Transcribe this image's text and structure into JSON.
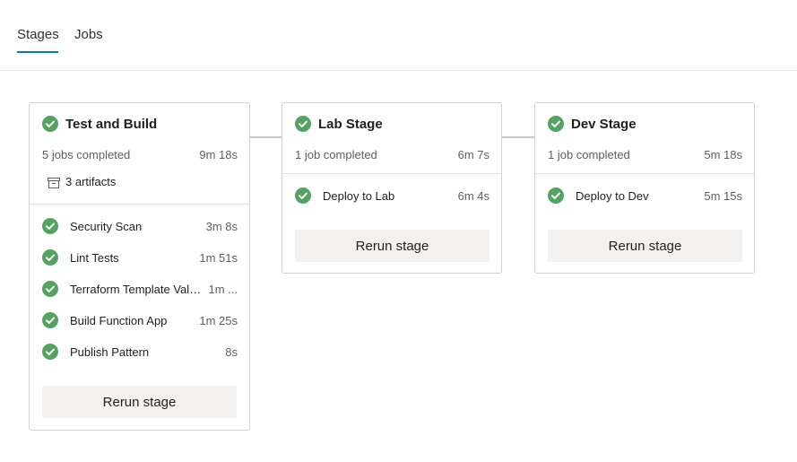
{
  "tabs": [
    {
      "label": "Stages",
      "active": true
    },
    {
      "label": "Jobs",
      "active": false
    }
  ],
  "colors": {
    "success": "#55a362",
    "accent": "#0078d4",
    "button_bg": "#f3f2f1"
  },
  "stages": [
    {
      "name": "Test and Build",
      "status_icon": "check-circle-icon",
      "jobs_completed": "5 jobs completed",
      "duration": "9m 18s",
      "artifacts": "3 artifacts",
      "jobs": [
        {
          "name": "Security Scan",
          "duration": "3m 8s"
        },
        {
          "name": "Lint Tests",
          "duration": "1m 51s"
        },
        {
          "name": "Terraform Template Validation",
          "duration": "1m ..."
        },
        {
          "name": "Build Function App",
          "duration": "1m 25s"
        },
        {
          "name": "Publish Pattern",
          "duration": "8s"
        }
      ],
      "rerun_label": "Rerun stage"
    },
    {
      "name": "Lab Stage",
      "status_icon": "check-circle-icon",
      "jobs_completed": "1 job completed",
      "duration": "6m 7s",
      "jobs": [
        {
          "name": "Deploy to Lab",
          "duration": "6m 4s"
        }
      ],
      "rerun_label": "Rerun stage"
    },
    {
      "name": "Dev Stage",
      "status_icon": "check-circle-icon",
      "jobs_completed": "1 job completed",
      "duration": "5m 18s",
      "jobs": [
        {
          "name": "Deploy to Dev",
          "duration": "5m 15s"
        }
      ],
      "rerun_label": "Rerun stage"
    }
  ]
}
